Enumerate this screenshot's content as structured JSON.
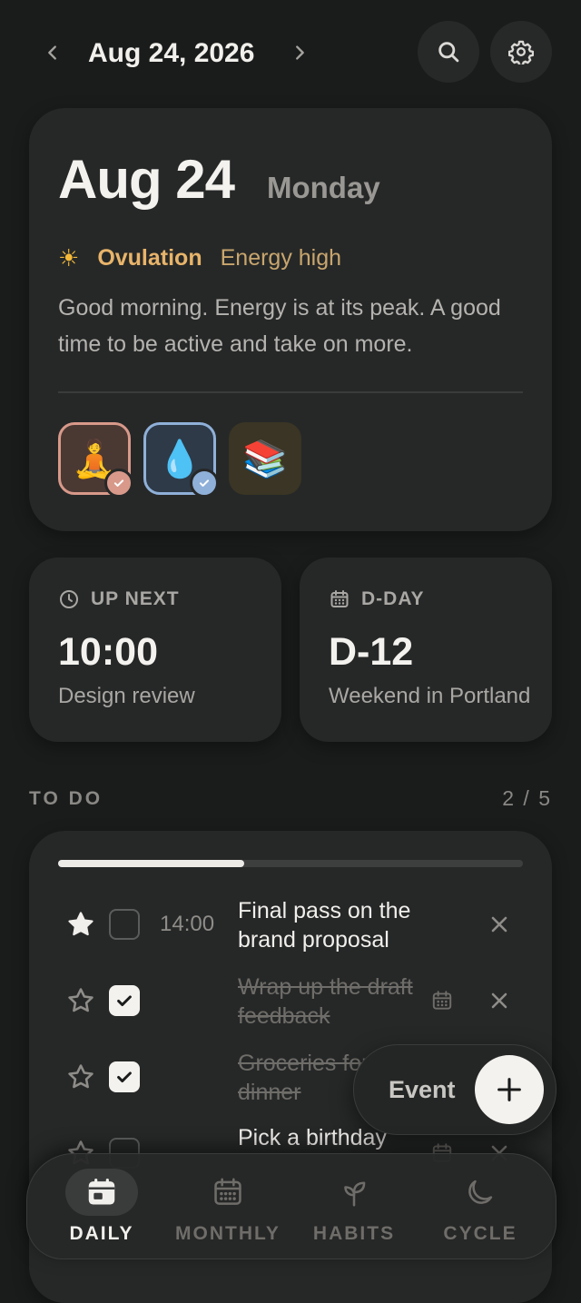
{
  "header": {
    "date": "Aug 24, 2026",
    "prev_icon": "chevron-left-icon",
    "next_icon": "chevron-right-icon",
    "search_icon": "search-icon",
    "settings_icon": "gear-icon"
  },
  "today": {
    "date": "Aug 24",
    "weekday": "Monday",
    "phase_icon": "☀",
    "phase": "Ovulation",
    "energy": "Energy high",
    "message": "Good morning. Energy is at its peak. A good time to be active and take on more.",
    "habits": [
      {
        "emoji": "🧘",
        "done": true,
        "color": "#d8998a"
      },
      {
        "emoji": "💧",
        "done": true,
        "color": "#8fb0d8"
      },
      {
        "emoji": "📚",
        "done": false,
        "color": ""
      }
    ]
  },
  "up_next": {
    "label": "UP NEXT",
    "time": "10:00",
    "title": "Design review"
  },
  "dday": {
    "label": "D-DAY",
    "countdown": "D-12",
    "title": "Weekend in Portland"
  },
  "todo": {
    "label": "TO DO",
    "count": "2 / 5",
    "progress": 0.4,
    "items": [
      {
        "starred": true,
        "checked": false,
        "time": "14:00",
        "text": "Final pass on the brand proposal",
        "has_calendar": false
      },
      {
        "starred": false,
        "checked": true,
        "time": "",
        "text": "Wrap up the draft feedback",
        "has_calendar": true
      },
      {
        "starred": false,
        "checked": true,
        "time": "",
        "text": "Groceries for dinner",
        "has_calendar": false
      },
      {
        "starred": false,
        "checked": false,
        "time": "",
        "text": "Pick a birthday",
        "has_calendar": true
      }
    ]
  },
  "fab": {
    "label": "Event",
    "icon": "plus-icon"
  },
  "tabs": [
    {
      "label": "DAILY",
      "icon": "calendar-day-icon",
      "active": true
    },
    {
      "label": "MONTHLY",
      "icon": "calendar-grid-icon",
      "active": false
    },
    {
      "label": "HABITS",
      "icon": "sprout-icon",
      "active": false
    },
    {
      "label": "CYCLE",
      "icon": "moon-icon",
      "active": false
    }
  ],
  "colors": {
    "background": "#1a1c1c",
    "card": "#262828",
    "phase_accent": "#e8b46a"
  }
}
